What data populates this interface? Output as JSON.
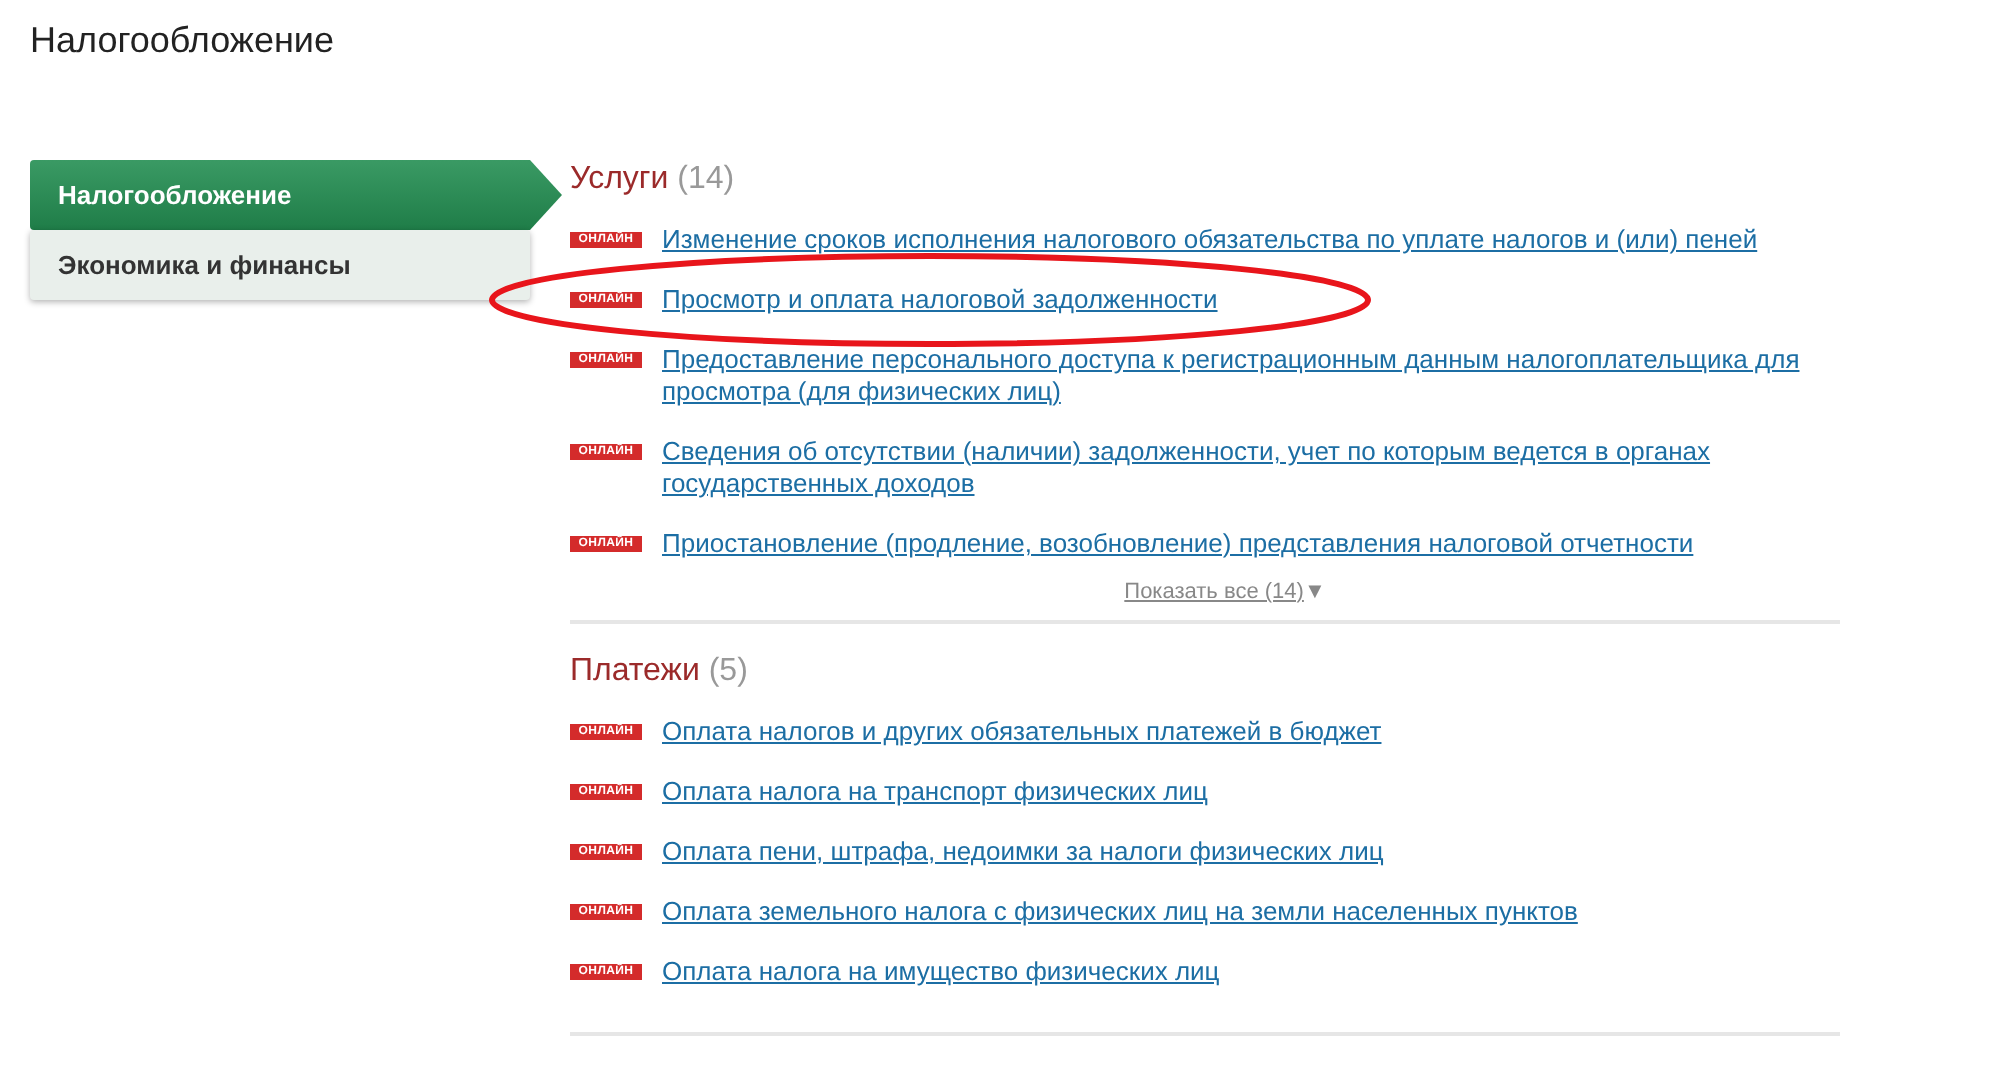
{
  "page_title": "Налогообложение",
  "sidebar": {
    "items": [
      {
        "label": "Налогообложение",
        "selected": true
      },
      {
        "label": "Экономика и финансы",
        "selected": false
      }
    ]
  },
  "sections": [
    {
      "title": "Услуги",
      "count": "(14)",
      "items": [
        {
          "badge": "ОНЛАЙН",
          "label": "Изменение сроков исполнения налогового обязательства по уплате налогов и (или) пеней",
          "highlighted": false
        },
        {
          "badge": "ОНЛАЙН",
          "label": "Просмотр и оплата налоговой задолженности",
          "highlighted": true
        },
        {
          "badge": "ОНЛАЙН",
          "label": "Предоставление персонального доступа к регистрационным данным налогоплательщика для просмотра (для физических лиц)",
          "highlighted": false
        },
        {
          "badge": "ОНЛАЙН",
          "label": "Сведения об отсутствии (наличии) задолженности, учет по которым ведется в органах государственных доходов",
          "highlighted": false
        },
        {
          "badge": "ОНЛАЙН",
          "label": "Приостановление (продление, возобновление) представления налоговой отчетности",
          "highlighted": false
        }
      ],
      "show_all": "Показать все (14)",
      "show_all_arrow": "▼"
    },
    {
      "title": "Платежи",
      "count": "(5)",
      "items": [
        {
          "badge": "ОНЛАЙН",
          "label": "Оплата налогов и других обязательных платежей в бюджет",
          "highlighted": false
        },
        {
          "badge": "ОНЛАЙН",
          "label": "Оплата налога на транспорт физических лиц",
          "highlighted": false
        },
        {
          "badge": "ОНЛАЙН",
          "label": "Оплата пени, штрафа, недоимки за налоги физических лиц",
          "highlighted": false
        },
        {
          "badge": "ОНЛАЙН",
          "label": "Оплата земельного налога с физических лиц на земли населенных пунктов",
          "highlighted": false
        },
        {
          "badge": "ОНЛАЙН",
          "label": "Оплата налога на имущество физических лиц",
          "highlighted": false
        }
      ]
    }
  ]
}
